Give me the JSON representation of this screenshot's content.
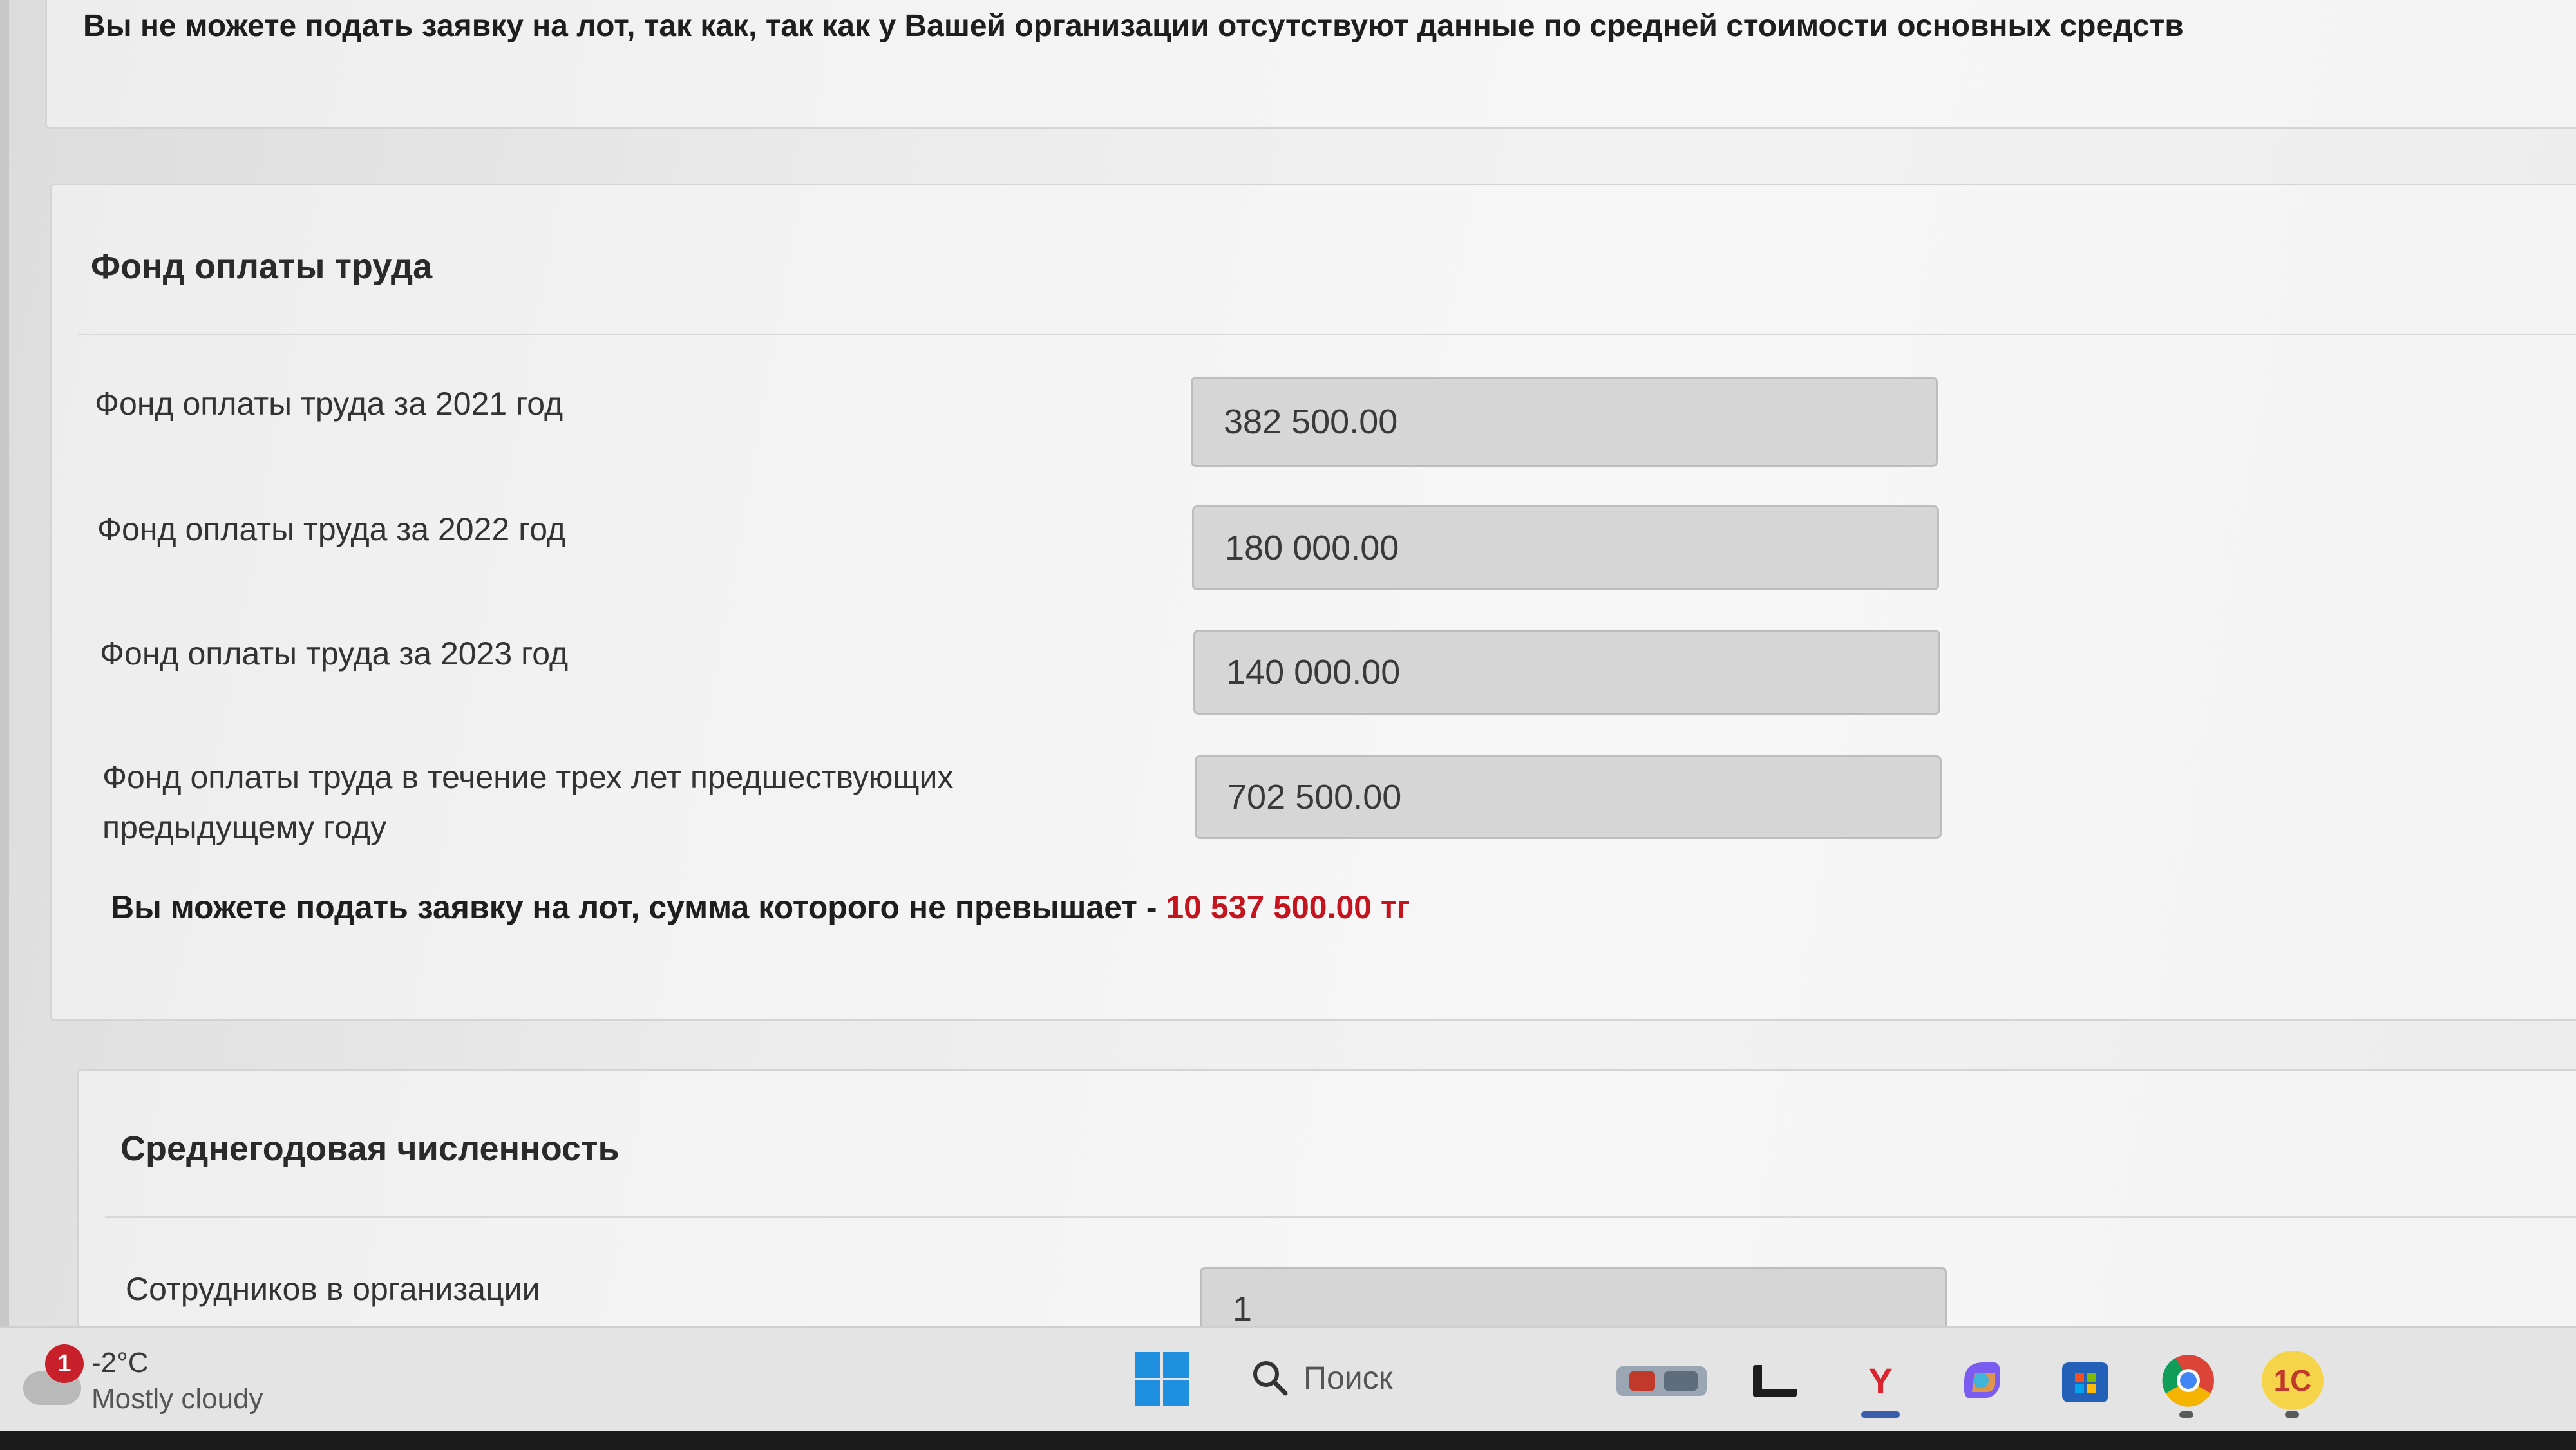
{
  "warning": {
    "text": "Вы не можете подать заявку на лот, так как, так как у Вашей организации отсутствуют данные по средней стоимости основных средств"
  },
  "fot": {
    "title": "Фонд оплаты труда",
    "fields": [
      {
        "label": "Фонд оплаты труда за 2021 год",
        "value": "382 500.00"
      },
      {
        "label": "Фонд оплаты труда за 2022 год",
        "value": "180 000.00"
      },
      {
        "label": "Фонд оплаты труда за 2023 год",
        "value": "140 000.00"
      },
      {
        "label": "Фонд оплаты труда в течение трех лет предшествующих предыдущему году",
        "value": "702 500.00"
      }
    ],
    "limit_text": "Вы можете подать заявку на лот, сумма которого не превышает - ",
    "limit_amount": "10 537 500.00 тг"
  },
  "staff": {
    "title": "Среднегодовая численность",
    "fields": [
      {
        "label": "Сотрудников в организации",
        "value": "1"
      }
    ]
  },
  "taskbar": {
    "weather_badge": "1",
    "weather_temp": "-2°C",
    "weather_desc": "Mostly cloudy",
    "search_placeholder": "Поиск",
    "apps": [
      "news-widget-icon",
      "file-explorer-icon",
      "yandex-browser-icon",
      "copilot-icon",
      "microsoft-store-icon",
      "chrome-icon",
      "1c-icon"
    ],
    "app_1c_label": "1С",
    "app_yandex_label": "Y"
  },
  "colors": {
    "limit_amount": "#c4141e",
    "windows_blue": "#1f8fe0"
  }
}
